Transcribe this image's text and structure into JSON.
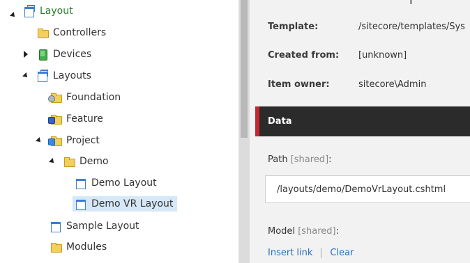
{
  "tree": {
    "items": [
      {
        "label": "Layout"
      },
      {
        "label": "Controllers"
      },
      {
        "label": "Devices"
      },
      {
        "label": "Layouts"
      },
      {
        "label": "Foundation"
      },
      {
        "label": "Feature"
      },
      {
        "label": "Project"
      },
      {
        "label": "Demo"
      },
      {
        "label": "Demo Layout"
      },
      {
        "label": "Demo VR Layout"
      },
      {
        "label": "Sample Layout"
      },
      {
        "label": "Modules"
      }
    ]
  },
  "info": {
    "template_key": "Template:",
    "template_value": "/sitecore/templates/Sys",
    "created_key": "Created from:",
    "created_value": "[unknown]",
    "owner_key": "Item owner:",
    "owner_value": "sitecore\\Admin"
  },
  "section": {
    "title": "Data",
    "accent_color": "#c8262d"
  },
  "fields": {
    "path_label": "Path",
    "path_shared": "[shared]",
    "path_colon": ":",
    "path_value": "/layouts/demo/DemoVrLayout.cshtml",
    "model_label": "Model",
    "model_shared": "[shared]",
    "model_colon": ":",
    "insert_link": "Insert link",
    "clear": "Clear"
  }
}
